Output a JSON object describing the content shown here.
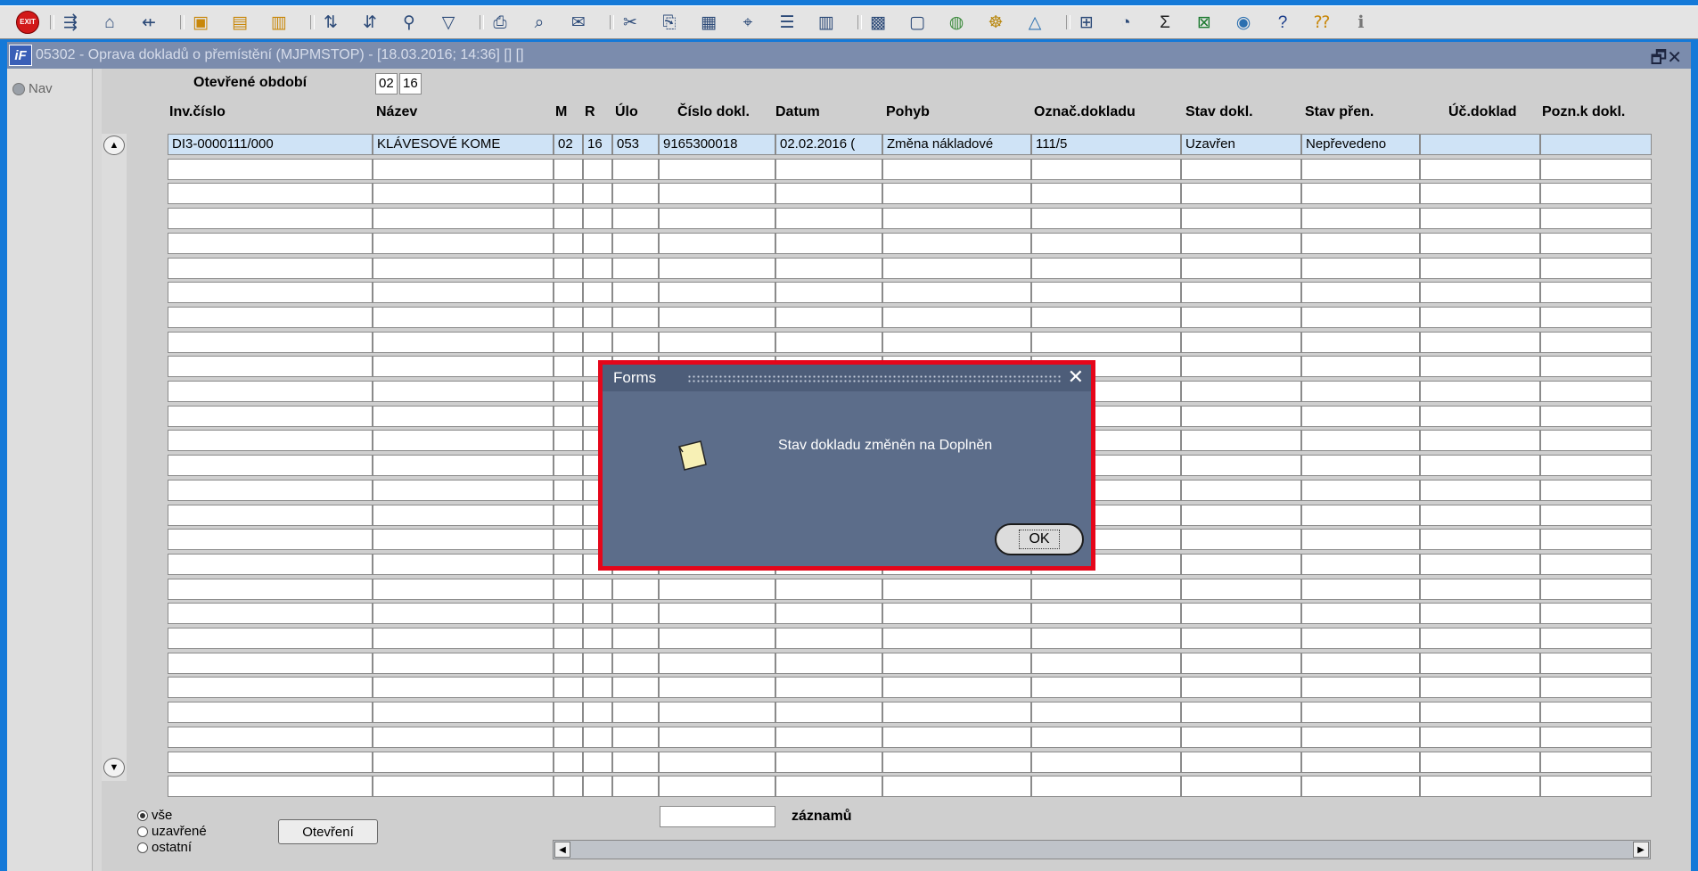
{
  "window": {
    "title": "05302 - Oprava dokladů o přemístění (MJPMSTOP) - [18.03.2016; 14:36] [] []",
    "app_icon": "iF",
    "controls": "🗗✕"
  },
  "toolbar": {
    "exit_label": "EXIT",
    "icons": [
      "exit-icon",
      "sep",
      "enter-query-icon",
      "home-icon",
      "cancel-query-icon",
      "sep",
      "new-record-icon",
      "duplicate-record-icon",
      "delete-record-icon",
      "sep",
      "sort-asc-icon",
      "sort-desc-icon",
      "tool-icon",
      "filter-icon",
      "sep",
      "print-icon",
      "print-preview-icon",
      "mail-icon",
      "sep",
      "cut-icon",
      "copy-icon",
      "paste-icon",
      "find-icon",
      "list-icon",
      "columns-icon",
      "sep",
      "save-icon",
      "form-icon",
      "globe-icon",
      "wheel-icon",
      "chart-icon",
      "sep",
      "attachment-icon",
      "clock-icon",
      "sum-icon",
      "excel-icon",
      "browser-icon",
      "help-icon",
      "info-icon",
      "about-icon"
    ]
  },
  "nav": {
    "label": "Nav"
  },
  "period": {
    "label": "Otevřené období",
    "month": "02",
    "year": "16"
  },
  "table": {
    "headers": [
      "Inv.číslo",
      "Název",
      "M",
      "R",
      "Úlo",
      "Číslo dokl.",
      "Datum",
      "Pohyb",
      "Označ.dokladu",
      "Stav dokl.",
      "Stav přen.",
      "Úč.doklad",
      "Pozn.k dokl."
    ],
    "first_row": [
      "DI3-0000111/000",
      "KLÁVESOVÉ KOME",
      "02",
      "16",
      "053",
      "9165300018",
      "02.02.2016 (",
      "Změna nákladové",
      "111/5",
      "Uzavřen",
      "Nepřevedeno",
      "",
      ""
    ]
  },
  "filter": {
    "options": [
      "vše",
      "uzavřené",
      "ostatní"
    ],
    "selected": "vše",
    "open_button": "Otevření"
  },
  "records": {
    "value": "",
    "label": "záznamů"
  },
  "dialog": {
    "title": "Forms",
    "close": "✕",
    "message": "Stav dokladu změněn na Doplněn",
    "ok": "OK"
  },
  "colors": {
    "desktop": "#1479d8",
    "highlight": "#e5061a",
    "dialog": "#5c6d8a"
  }
}
